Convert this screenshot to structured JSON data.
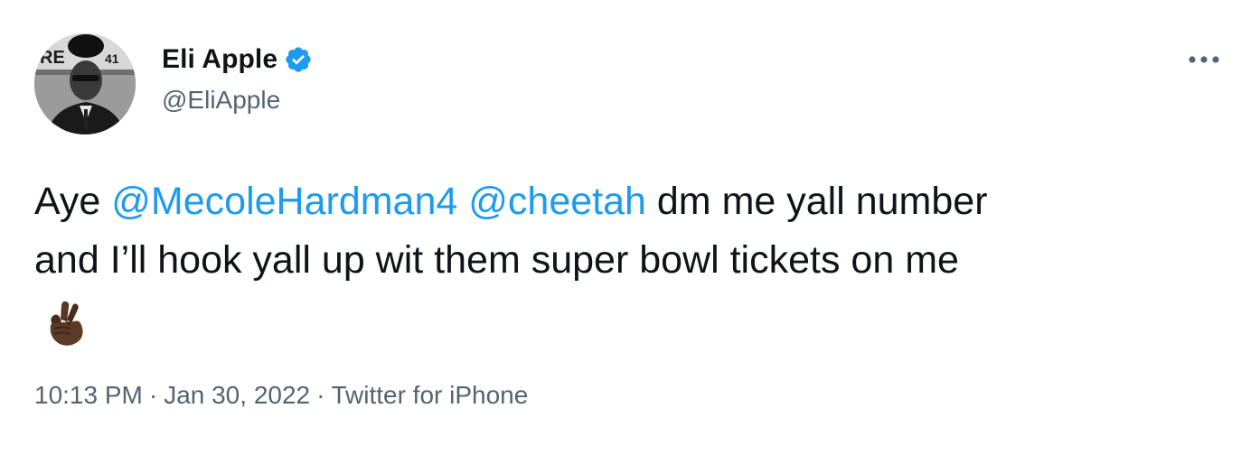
{
  "author": {
    "display_name": "Eli Apple",
    "handle": "@EliApple",
    "verified": true,
    "avatar_icon": "profile-photo-avatar"
  },
  "tweet": {
    "text_prefix": "Aye ",
    "mention_1": "@MecoleHardman4",
    "space_1": " ",
    "mention_2": "@cheetah",
    "text_line1_rest": " dm me yall number",
    "text_line2": "and I’ll hook yall up wit them super bowl tickets on me",
    "emoji": "crossed-fingers-dark-skin-tone"
  },
  "meta": {
    "time": "10:13 PM",
    "separator": "·",
    "date": "Jan 30, 2022",
    "source": "Twitter for iPhone"
  },
  "colors": {
    "mention": "#1d9bf0",
    "text": "#0f1419",
    "secondary": "#536471",
    "verified": "#1d9bf0"
  },
  "icons": {
    "more": "more-horizontal-icon",
    "verified": "verified-badge-icon"
  }
}
